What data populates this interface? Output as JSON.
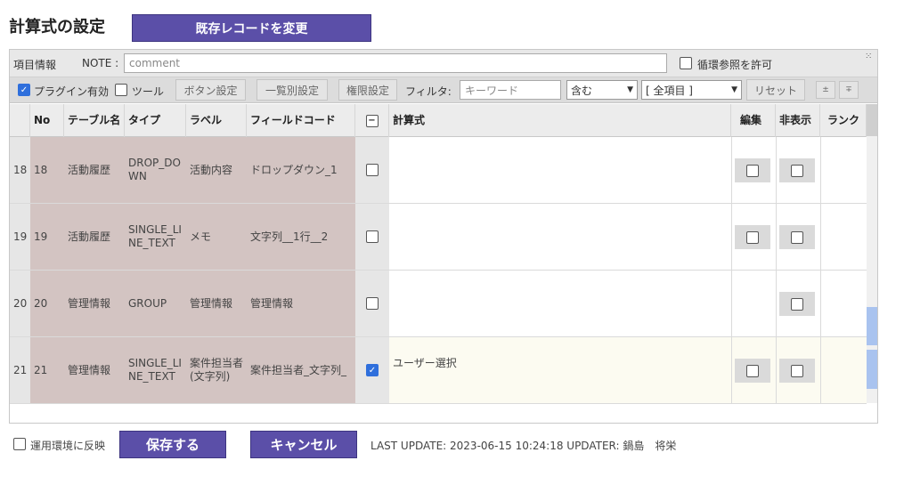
{
  "page": {
    "title": "計算式の設定",
    "change_record_button": "既存レコードを変更"
  },
  "toolbar1": {
    "item_info_label": "項目情報",
    "note_label": "NOTE :",
    "note_placeholder": "comment",
    "circular_ref_label": "循環参照を許可",
    "collapse_icon": "collapse-icon"
  },
  "toolbar2": {
    "plugin_enabled_label": "プラグイン有効",
    "tool_label": "ツール",
    "button_settings": "ボタン設定",
    "list_settings": "一覧別設定",
    "permission_settings": "権限設定",
    "filter_label": "フィルタ:",
    "keyword_placeholder": "キーワード",
    "match_select": "含む",
    "field_select": "[ 全項目 ]",
    "reset_button": "リセット",
    "sort_up": "±",
    "sort_down": "∓"
  },
  "table": {
    "headers": {
      "no": "No",
      "table_name": "テーブル名",
      "type": "タイプ",
      "label": "ラベル",
      "field_code": "フィールドコード",
      "formula": "計算式",
      "edit": "編集",
      "hide": "非表示",
      "rank": "ランク"
    },
    "rows": [
      {
        "index": "18",
        "no": "18",
        "table_name": "活動履歴",
        "type": "DROP_DOWN",
        "label": "活動内容",
        "field_code": "ドロップダウン_1",
        "checked": false,
        "formula": "",
        "has_edit": true,
        "has_hide": true
      },
      {
        "index": "19",
        "no": "19",
        "table_name": "活動履歴",
        "type": "SINGLE_LINE_TEXT",
        "label": "メモ",
        "field_code": "文字列__1行__2",
        "checked": false,
        "formula": "",
        "has_edit": true,
        "has_hide": true
      },
      {
        "index": "20",
        "no": "20",
        "table_name": "管理情報",
        "type": "GROUP",
        "label": "管理情報",
        "field_code": "管理情報",
        "checked": false,
        "formula": "",
        "has_edit": false,
        "has_hide": true
      },
      {
        "index": "21",
        "no": "21",
        "table_name": "管理情報",
        "type": "SINGLE_LINE_TEXT",
        "label": "案件担当者(文字列)",
        "field_code": "案件担当者_文字列_",
        "checked": true,
        "formula": "ユーザー選択",
        "has_edit": true,
        "has_hide": true
      }
    ]
  },
  "footer": {
    "deploy_label": "運用環境に反映",
    "save_button": "保存する",
    "cancel_button": "キャンセル",
    "last_update": "LAST UPDATE: 2023-06-15 10:24:18 UPDATER: 鍋島　将栄"
  },
  "colors": {
    "accent": "#5b4fa8",
    "row_brown": "#d3c4c2",
    "checkbox_blue": "#2f6fdc"
  }
}
